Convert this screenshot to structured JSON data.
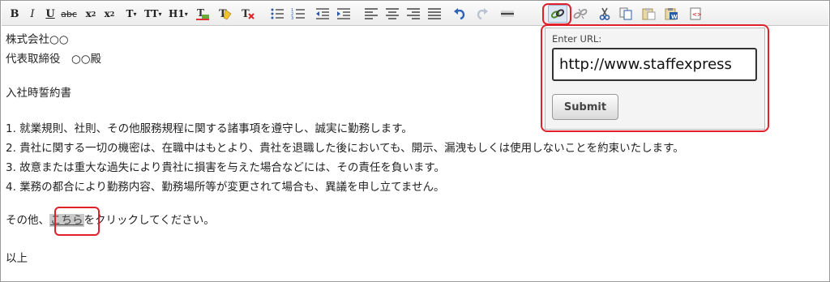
{
  "toolbar": {
    "bold": "B",
    "italic": "I",
    "underline": "U",
    "strikethrough": "abc",
    "subscript_base": "x",
    "subscript_mark": "2",
    "superscript_base": "x",
    "superscript_mark": "2",
    "font_size_label": "T",
    "font_family_label": "TT",
    "heading_label": "H1",
    "icons": [
      "text-color-icon",
      "highlight-icon",
      "clear-format-icon",
      "unordered-list-icon",
      "ordered-list-icon",
      "outdent-icon",
      "indent-icon",
      "align-left-icon",
      "align-center-icon",
      "align-right-icon",
      "justify-icon",
      "undo-icon",
      "redo-icon",
      "horizontal-rule-icon",
      "link-icon",
      "unlink-icon",
      "cut-icon",
      "copy-icon",
      "paste-icon",
      "paste-word-icon",
      "html-source-icon"
    ]
  },
  "document": {
    "lines": [
      "株式会社○○",
      "代表取締役　○○殿",
      "入社時誓約書",
      "1. 就業規則、社則、その他服務規程に関する諸事項を遵守し、誠実に勤務します。",
      "2. 貴社に関する一切の機密は、在職中はもとより、貴社を退職した後においても、開示、漏洩もしくは使用しないことを約束いたします。",
      "3. 故意または重大な過失により貴社に損害を与えた場合などには、その責任を負います。",
      "4. 業務の都合により勤務内容、勤務場所等が変更されて場合も、異議を申し立てません。"
    ],
    "click_prefix": "その他、",
    "link_text": "こちら",
    "click_suffix": "をクリックしてください。",
    "closing": "以上"
  },
  "url_popup": {
    "label": "Enter URL:",
    "value": "http://www.staffexpress",
    "submit_label": "Submit"
  },
  "colors": {
    "highlight_border": "#e0202a",
    "link_background": "#c9c9c9"
  }
}
